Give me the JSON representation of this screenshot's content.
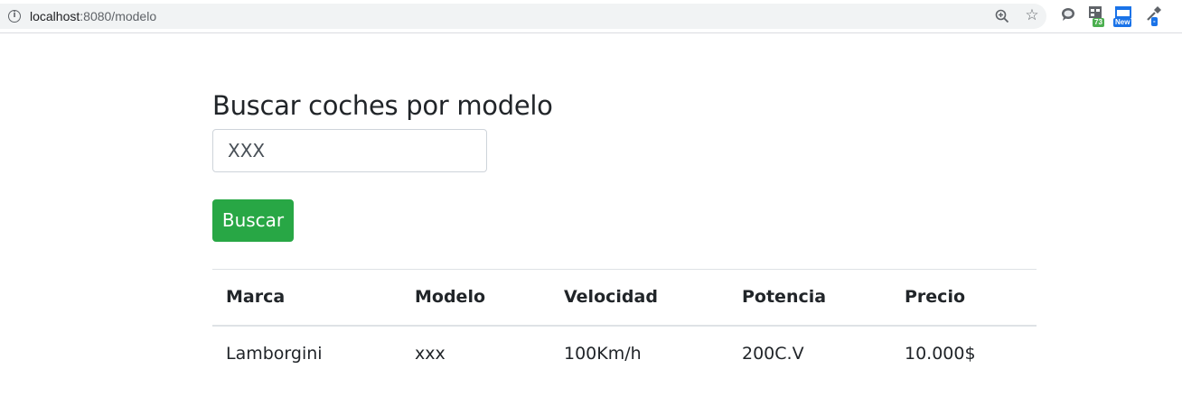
{
  "browser": {
    "url_host": "localhost",
    "url_path": ":8080/modelo",
    "extensions": [
      {
        "icon": "chat-bubble-icon"
      },
      {
        "icon": "grid-extension-icon",
        "badge": "73",
        "badge_color": "#4caf50"
      },
      {
        "icon": "window-extension-icon",
        "badge": "New",
        "badge_color": "#1a73e8"
      },
      {
        "icon": "eyedropper-icon",
        "badge": "-",
        "badge_color": "#1a73e8"
      }
    ]
  },
  "page": {
    "title": "Buscar coches por modelo",
    "search_input_value": "XXX",
    "search_button_label": "Buscar",
    "accent_color": "#28a745"
  },
  "table": {
    "headers": [
      "Marca",
      "Modelo",
      "Velocidad",
      "Potencia",
      "Precio"
    ],
    "rows": [
      [
        "Lamborgini",
        "xxx",
        "100Km/h",
        "200C.V",
        "10.000$"
      ]
    ]
  }
}
